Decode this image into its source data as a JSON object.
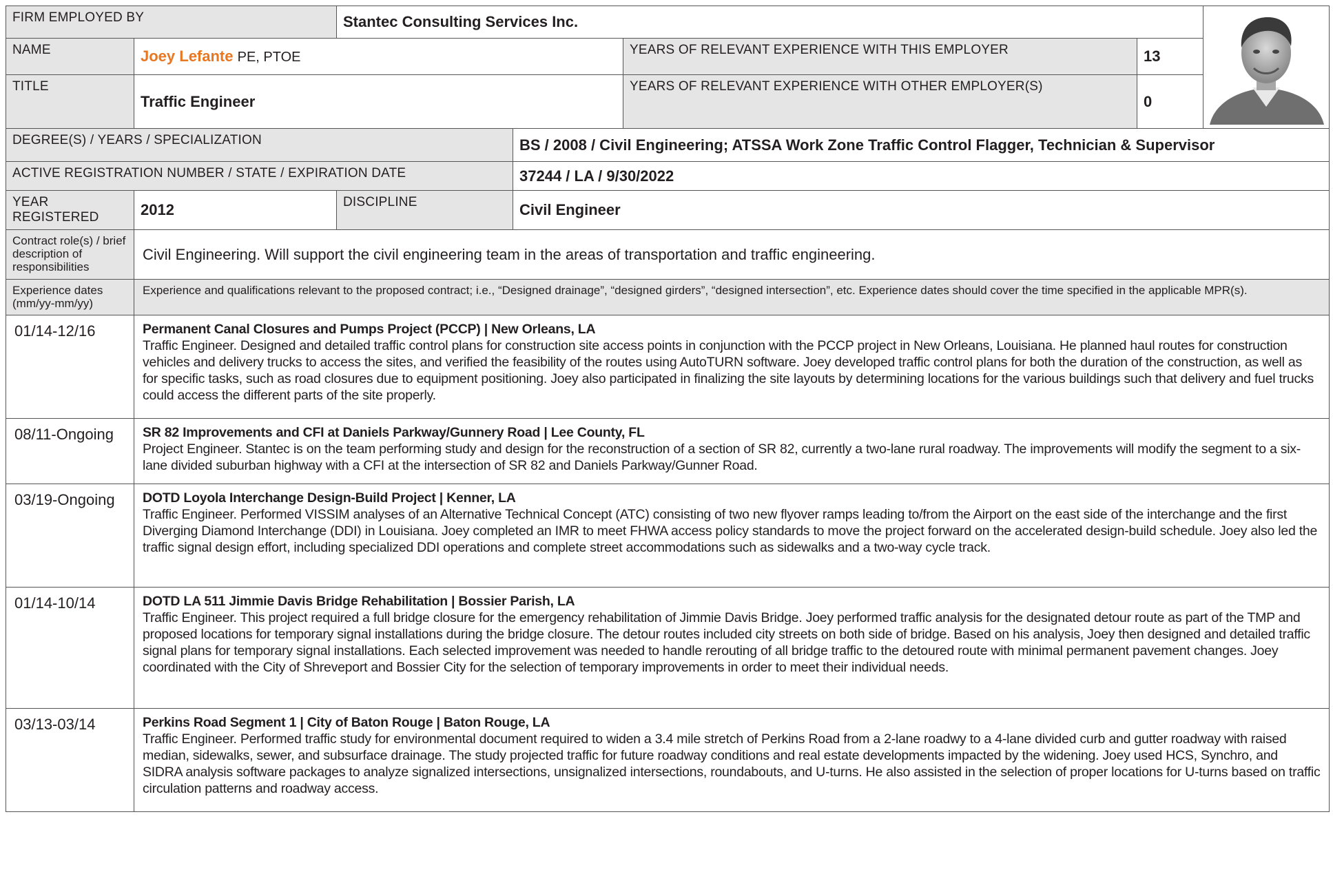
{
  "firm": {
    "label": "FIRM EMPLOYED BY",
    "value": "Stantec Consulting Services Inc."
  },
  "name": {
    "label": "NAME",
    "value": "Joey Lefante",
    "suffix": "PE, PTOE"
  },
  "exp_this": {
    "label": "YEARS OF RELEVANT EXPERIENCE WITH THIS EMPLOYER",
    "value": "13"
  },
  "title": {
    "label": "TITLE",
    "value": "Traffic Engineer"
  },
  "exp_other": {
    "label": "YEARS OF RELEVANT EXPERIENCE WITH OTHER EMPLOYER(S)",
    "value": "0"
  },
  "degree": {
    "label": "DEGREE(S) / YEARS / SPECIALIZATION",
    "value": "BS / 2008 / Civil Engineering; ATSSA Work Zone Traffic Control Flagger, Technician & Supervisor"
  },
  "registration": {
    "label": "ACTIVE REGISTRATION NUMBER / STATE / EXPIRATION DATE",
    "value": "37244 / LA / 9/30/2022"
  },
  "year_registered": {
    "label": "YEAR REGISTERED",
    "value": "2012"
  },
  "discipline": {
    "label": "DISCIPLINE",
    "value": "Civil Engineer"
  },
  "role": {
    "label": "Contract role(s) / brief description of responsibilities",
    "value": "Civil Engineering. Will support the civil engineering team in the areas of transportation and traffic engineering."
  },
  "experience_header": {
    "dates_label": "Experience dates (mm/yy-mm/yy)",
    "desc": "Experience and qualifications relevant to the proposed contract; i.e., “Designed drainage”, “designed girders”, “designed intersection”, etc. Experience dates should cover the time specified in the applicable MPR(s)."
  },
  "experience": [
    {
      "dates": "01/14-12/16",
      "title": "Permanent Canal Closures and Pumps Project (PCCP) | New Orleans, LA",
      "text": "Traffic Engineer. Designed and detailed traffic control plans for construction site access points in conjunction with the PCCP project in New Orleans, Louisiana. He planned haul routes for construction vehicles and delivery trucks to access the sites, and verified the feasibility of the routes using AutoTURN software. Joey developed traffic control plans for both the duration of the construction, as well as for specific tasks, such as road closures due to equipment positioning. Joey also participated in finalizing the site layouts by determining locations for the various buildings such that delivery and fuel trucks could access the different parts of the site properly."
    },
    {
      "dates": "08/11-Ongoing",
      "title": "SR 82 Improvements and CFI at Daniels Parkway/Gunnery Road | Lee County, FL",
      "text": "Project Engineer. Stantec is on the team performing study and design for the reconstruction of a section of SR 82, currently a two-lane rural roadway. The improvements will modify the segment to a six-lane divided suburban highway with a CFI at the intersection of SR 82 and Daniels Parkway/Gunner Road."
    },
    {
      "dates": "03/19-Ongoing",
      "title": "DOTD Loyola Interchange Design-Build Project | Kenner, LA",
      "text": "Traffic Engineer. Performed VISSIM analyses of an Alternative Technical Concept (ATC) consisting of two new flyover ramps leading to/from the Airport on the east side of the interchange and the first Diverging Diamond Interchange (DDI) in Louisiana. Joey completed an IMR to meet FHWA access policy standards to move the project forward on the accelerated design-build schedule. Joey also led the traffic signal design effort, including specialized DDI operations and complete street accommodations such as sidewalks and a two-way cycle track."
    },
    {
      "dates": "01/14-10/14",
      "title": "DOTD LA 511 Jimmie Davis Bridge Rehabilitation | Bossier Parish, LA",
      "text": "Traffic Engineer. This project required a full bridge closure for the emergency rehabilitation of Jimmie Davis Bridge. Joey performed traffic analysis for the designated detour route as part of the TMP and proposed locations for temporary signal installations during the bridge closure. The detour routes included city streets on both side of bridge. Based on his analysis, Joey then designed and detailed traffic signal plans for temporary signal installations. Each selected improvement was needed to handle rerouting of all bridge traffic to the detoured route with minimal permanent pavement changes. Joey coordinated with the City of Shreveport and Bossier City for the selection of temporary improvements in order to meet their individual needs."
    },
    {
      "dates": "03/13-03/14",
      "title": "Perkins Road Segment 1 | City of Baton Rouge | Baton Rouge, LA",
      "text": "Traffic Engineer. Performed traffic study for environmental document required to widen a 3.4 mile stretch of Perkins Road from a 2-lane roadwy to a 4-lane divided curb and gutter roadway with raised median, sidewalks, sewer, and subsurface drainage. The study projected traffic for future roadway conditions and real estate developments impacted by the widening. Joey used HCS, Synchro, and SIDRA analysis software packages to analyze signalized intersections, unsignalized intersections, roundabouts, and U-turns. He also assisted in the selection of proper locations for U-turns based on traffic circulation patterns and roadway access."
    }
  ]
}
